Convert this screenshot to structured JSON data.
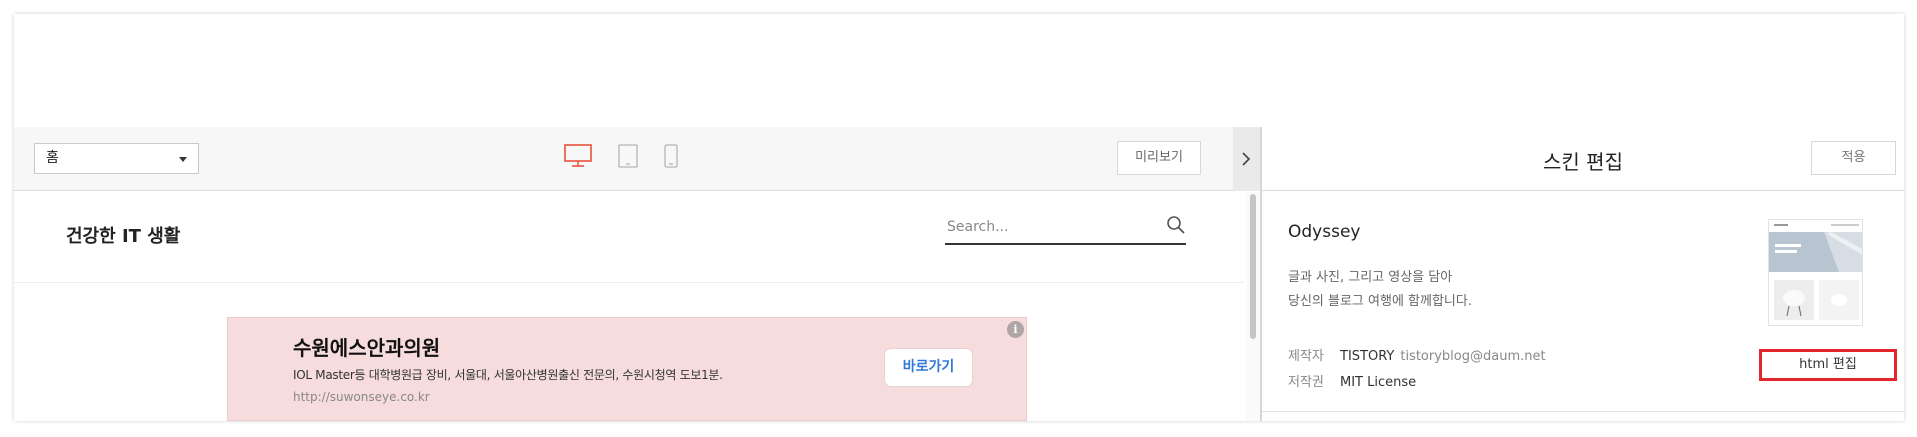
{
  "toolbar": {
    "page_select_value": "홈",
    "preview_label": "미리보기"
  },
  "preview": {
    "blog_title": "건강한 IT 생활",
    "search_placeholder": "Search...",
    "ad": {
      "title": "수원에스안과의원",
      "description": "IOL Master등 대학병원급 장비, 서울대, 서울아산병원출신 전문의, 수원시청역 도보1분.",
      "url": "http://suwonseye.co.kr",
      "cta": "바로가기",
      "info_glyph": "i"
    }
  },
  "skin_panel": {
    "title": "스킨 편집",
    "apply_label": "적용",
    "skin_name": "Odyssey",
    "description_lines": [
      "글과 사진, 그리고 영상을 담아",
      "당신의 블로그 여행에 함께합니다."
    ],
    "author_label": "제작자",
    "author_name": "TISTORY",
    "author_email": "tistoryblog@daum.net",
    "license_label": "저작권",
    "license_value": "MIT License",
    "html_edit_label": "html 편집"
  },
  "colors": {
    "accent": "#e3262b",
    "active_device": "#e8523b",
    "ad_background": "#f6dcdd",
    "ad_button_text": "#2e79d9"
  },
  "icons": [
    "dropdown-caret-icon",
    "desktop-icon",
    "tablet-icon",
    "mobile-icon",
    "chevron-right-icon",
    "search-icon",
    "info-icon"
  ]
}
